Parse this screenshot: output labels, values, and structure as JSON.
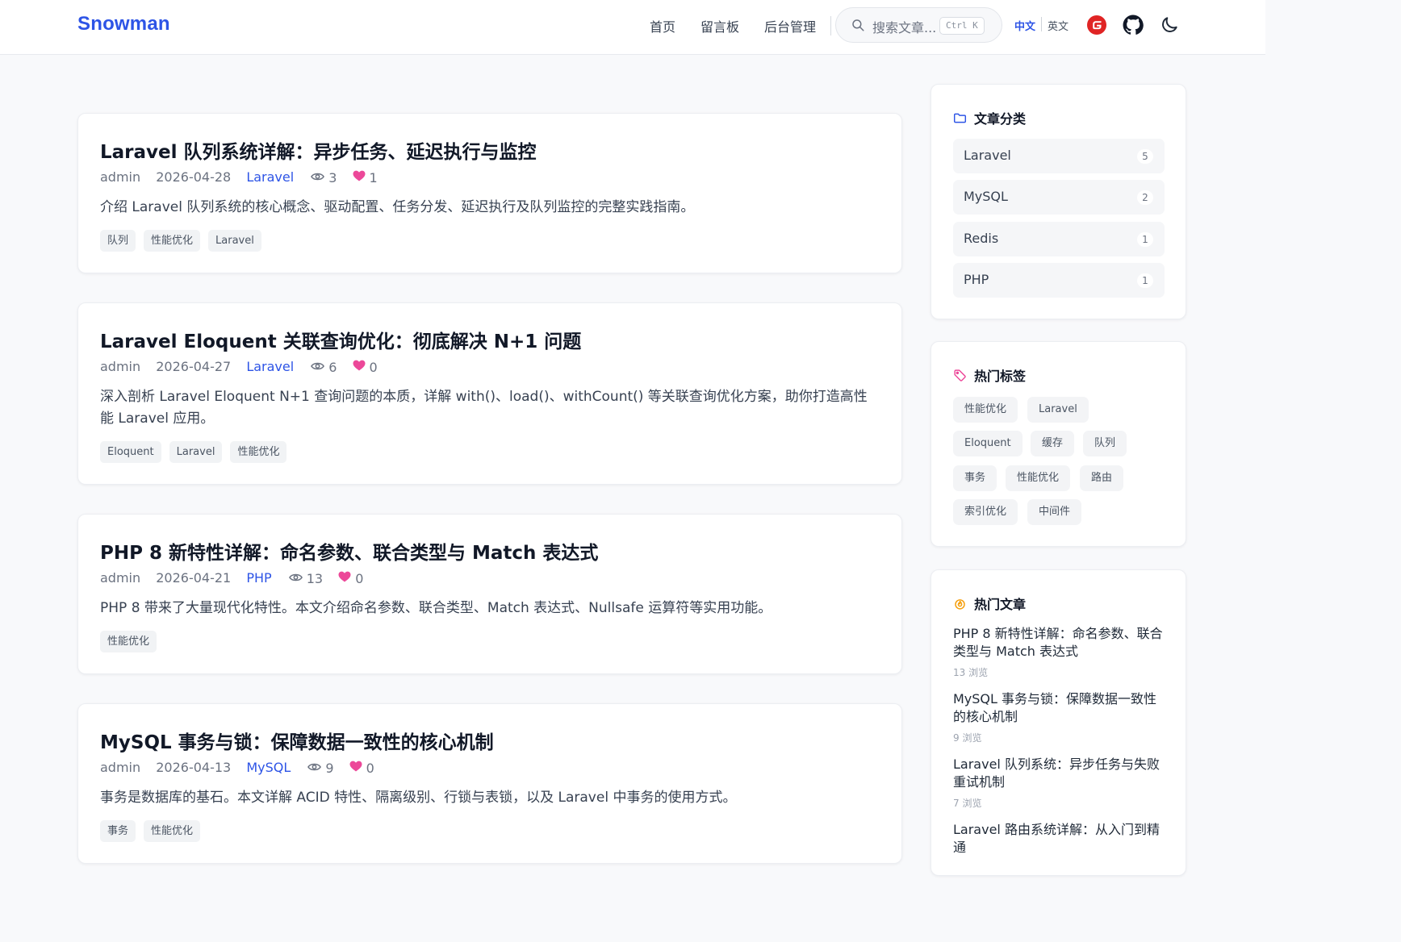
{
  "header": {
    "brand": "Snowman",
    "nav": [
      "首页",
      "留言板",
      "后台管理"
    ],
    "search_placeholder": "搜索文章...",
    "search_shortcut": "Ctrl K",
    "lang_active": "中文",
    "lang_other": "英文",
    "accent_color": "#2d54e6"
  },
  "posts": [
    {
      "title": "Laravel 队列系统详解：异步任务、延迟执行与监控",
      "author": "admin",
      "date": "2026-04-28",
      "category": "Laravel",
      "views": "3",
      "likes": "1",
      "excerpt": "介绍 Laravel 队列系统的核心概念、驱动配置、任务分发、延迟执行及队列监控的完整实践指南。",
      "tags": [
        "队列",
        "性能优化",
        "Laravel"
      ]
    },
    {
      "title": "Laravel Eloquent 关联查询优化：彻底解决 N+1 问题",
      "author": "admin",
      "date": "2026-04-27",
      "category": "Laravel",
      "views": "6",
      "likes": "0",
      "excerpt": "深入剖析 Laravel Eloquent N+1 查询问题的本质，详解 with()、load()、withCount() 等关联查询优化方案，助你打造高性能 Laravel 应用。",
      "tags": [
        "Eloquent",
        "Laravel",
        "性能优化"
      ]
    },
    {
      "title": "PHP 8 新特性详解：命名参数、联合类型与 Match 表达式",
      "author": "admin",
      "date": "2026-04-21",
      "category": "PHP",
      "views": "13",
      "likes": "0",
      "excerpt": "PHP 8 带来了大量现代化特性。本文介绍命名参数、联合类型、Match 表达式、Nullsafe 运算符等实用功能。",
      "tags": [
        "性能优化"
      ]
    },
    {
      "title": "MySQL 事务与锁：保障数据一致性的核心机制",
      "author": "admin",
      "date": "2026-04-13",
      "category": "MySQL",
      "views": "9",
      "likes": "0",
      "excerpt": "事务是数据库的基石。本文详解 ACID 特性、隔离级别、行锁与表锁，以及 Laravel 中事务的使用方式。",
      "tags": [
        "事务",
        "性能优化"
      ]
    }
  ],
  "sidebar": {
    "categories_title": "文章分类",
    "categories": [
      {
        "name": "Laravel",
        "count": "5"
      },
      {
        "name": "MySQL",
        "count": "2"
      },
      {
        "name": "Redis",
        "count": "1"
      },
      {
        "name": "PHP",
        "count": "1"
      }
    ],
    "tags_title": "热门标签",
    "tags": [
      "性能优化",
      "Laravel",
      "Eloquent",
      "缓存",
      "队列",
      "事务",
      "性能优化",
      "路由",
      "索引优化",
      "中间件"
    ],
    "hot_title": "热门文章",
    "hot": [
      {
        "title": "PHP 8 新特性详解：命名参数、联合类型与 Match 表达式",
        "views": "13 浏览"
      },
      {
        "title": "MySQL 事务与锁：保障数据一致性的核心机制",
        "views": "9 浏览"
      },
      {
        "title": "Laravel 队列系统：异步任务与失败重试机制",
        "views": "7 浏览"
      },
      {
        "title": "Laravel 路由系统详解：从入门到精通",
        "views": ""
      }
    ]
  }
}
